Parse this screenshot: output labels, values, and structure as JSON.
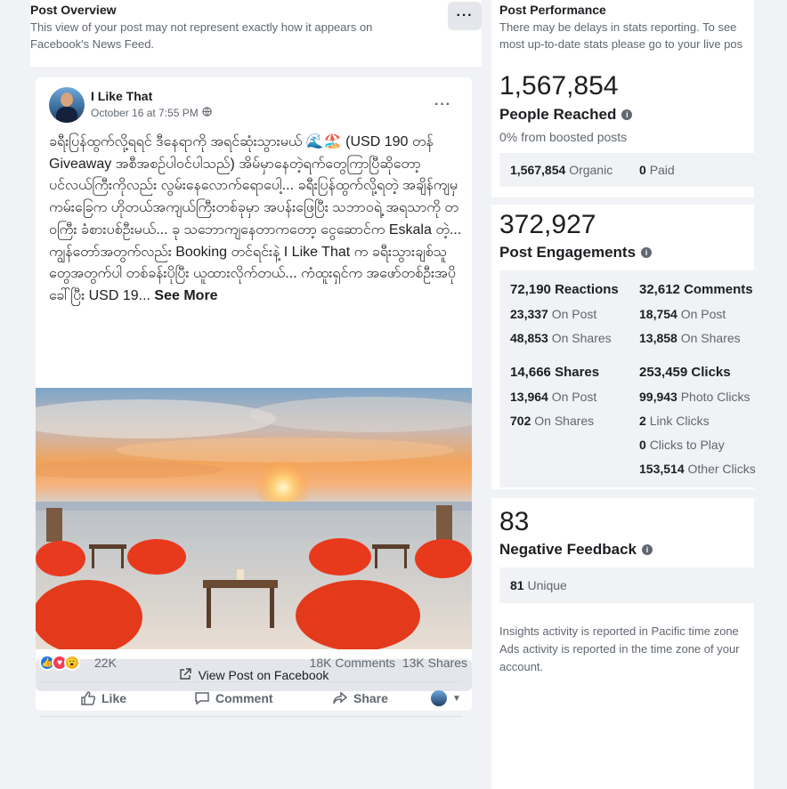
{
  "overview": {
    "title": "Post Overview",
    "subtitle": "This view of your post may not represent exactly how it appears on Facebook's News Feed.",
    "more_label": "···"
  },
  "post": {
    "page_name": "I Like That",
    "date": "October 16 at 7:55 PM",
    "more_label": "···",
    "text": "ခရီးပြန်ထွက်လို့ရရင် ဒီနေရာကို အရင်ဆုံးသွားမယ် 🌊🏖️ (USD 190 တန် Giveaway အစီအစဉ်ပါဝင်ပါသည်) အိမ်မှာနေတဲ့ရက်တွေကြာပြီဆိုတော့ ပင်လယ်ကြီးကိုလည်း လွမ်းနေလောက်ရောပေါ့... ခရီးပြန်ထွက်လို့ရတဲ့ အချိန်ကျမှ ကမ်းခြေက ဟိုတယ်အကျယ်ကြီးတစ်ခုမှာ အပန်းဖြေပြီး သဘာဝရဲ့ အရသာကို တဝကြီး ခံစားပစ်ဦးမယ်... ခု သဘောကျနေတာကတော့ ငွေဆောင်က Eskala တဲ့... ကျွန်တော်အတွက်လည်း Booking တင်ရင်းနဲ့ I Like That က ခရီးသွားချစ်သူတွေအတွက်ပါ တစ်ခန်းပိုပြီး ယူထားလိုက်တယ်... ကံထူးရှင်က အဖော်တစ်ဦးအပိုခေါ်ပြီး USD 19...",
    "see_more": "See More",
    "view_button": "View Post on Facebook",
    "reactions_count": "22K",
    "comments_shares": "18K Comments  13K Shares",
    "actions": {
      "like": "Like",
      "comment": "Comment",
      "share": "Share"
    }
  },
  "performance": {
    "title": "Post Performance",
    "subtitle_line1": "There may be delays in stats reporting. To see",
    "subtitle_line2": "most up-to-date stats please go to your live pos",
    "reached": {
      "value": "1,567,854",
      "label": "People Reached",
      "note": "0% from boosted posts",
      "organic_value": "1,567,854",
      "organic_label": "Organic",
      "paid_value": "0",
      "paid_label": "Paid"
    },
    "engagements": {
      "value": "372,927",
      "label": "Post Engagements",
      "reactions": {
        "value": "72,190",
        "label": "Reactions",
        "on_post": "23,337",
        "on_shares": "48,853"
      },
      "comments": {
        "value": "32,612",
        "label": "Comments",
        "on_post": "18,754",
        "on_shares": "13,858"
      },
      "shares": {
        "value": "14,666",
        "label": "Shares",
        "on_post": "13,964",
        "on_shares": "702"
      },
      "clicks": {
        "value": "253,459",
        "label": "Clicks",
        "photo": "99,943",
        "photo_label": "Photo Clicks",
        "link": "2",
        "link_label": "Link Clicks",
        "play": "0",
        "play_label": "Clicks to Play",
        "other": "153,514",
        "other_label": "Other Clicks"
      },
      "on_post_label": "On Post",
      "on_shares_label": "On Shares"
    },
    "negative": {
      "value": "83",
      "label": "Negative Feedback",
      "unique_value": "81",
      "unique_label": "Unique"
    },
    "footer": {
      "line1": "Insights activity is reported in Pacific time zone",
      "line2": "Ads activity is reported in the time zone of your",
      "line3": "account."
    }
  },
  "colors": {
    "accent": "#1877f2",
    "panel": "#f0f2f5",
    "text": "#1c1e21",
    "muted": "#606770"
  }
}
